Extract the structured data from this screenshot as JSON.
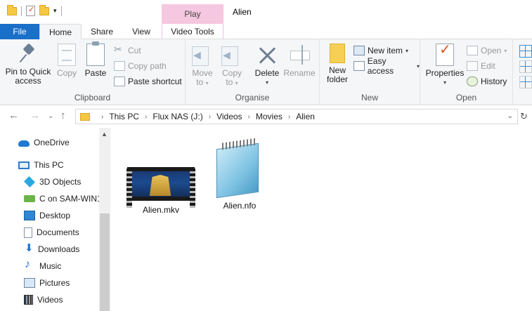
{
  "window": {
    "title": "Alien",
    "context_tab_header": "Play"
  },
  "tabs": {
    "file": "File",
    "home": "Home",
    "share": "Share",
    "view": "View",
    "video_tools": "Video Tools"
  },
  "ribbon": {
    "clipboard": {
      "label": "Clipboard",
      "pin_line1": "Pin to Quick",
      "pin_line2": "access",
      "copy": "Copy",
      "paste": "Paste",
      "cut": "Cut",
      "copy_path": "Copy path",
      "paste_shortcut": "Paste shortcut"
    },
    "organise": {
      "label": "Organise",
      "move_to": "Move",
      "move_to2": "to",
      "copy_to": "Copy",
      "copy_to2": "to",
      "delete": "Delete",
      "rename": "Rename"
    },
    "new": {
      "label": "New",
      "new_folder1": "New",
      "new_folder2": "folder",
      "new_item": "New item",
      "easy_access": "Easy access"
    },
    "open": {
      "label": "Open",
      "properties": "Properties",
      "open": "Open",
      "edit": "Edit",
      "history": "History"
    }
  },
  "address": {
    "crumbs": [
      "This PC",
      "Flux NAS (J:)",
      "Videos",
      "Movies",
      "Alien"
    ]
  },
  "nav_pane": {
    "items": [
      {
        "label": "OneDrive",
        "icon": "onedrive-icon"
      },
      {
        "label": "This PC",
        "icon": "this-pc-icon"
      },
      {
        "label": "3D Objects",
        "icon": "3d-objects-icon"
      },
      {
        "label": "C on SAM-WIN1",
        "icon": "network-drive-icon"
      },
      {
        "label": "Desktop",
        "icon": "desktop-icon"
      },
      {
        "label": "Documents",
        "icon": "documents-icon"
      },
      {
        "label": "Downloads",
        "icon": "downloads-icon"
      },
      {
        "label": "Music",
        "icon": "music-icon"
      },
      {
        "label": "Pictures",
        "icon": "pictures-icon"
      },
      {
        "label": "Videos",
        "icon": "videos-icon"
      }
    ]
  },
  "files": [
    {
      "name": "Alien.mkv",
      "icon": "video-thumbnail-icon"
    },
    {
      "name": "Alien.nfo",
      "icon": "notepad-icon"
    }
  ],
  "colors": {
    "file_tab": "#1a6fc9",
    "play_tab": "#f6c7e0",
    "ribbon_bg": "#f5f6f7"
  }
}
